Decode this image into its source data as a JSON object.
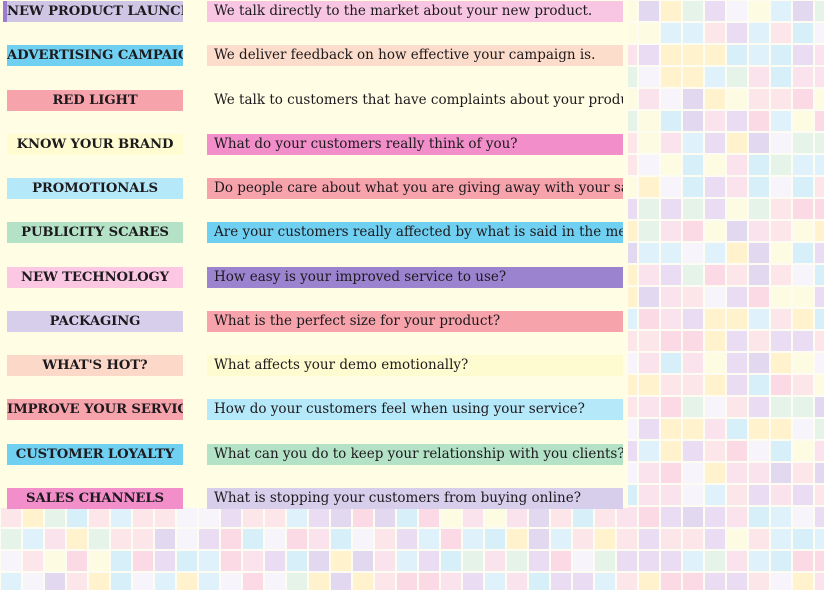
{
  "colors": {
    "panel": "#fffde3",
    "mosaic": [
      "#fbe3ee",
      "#e9dcf3",
      "#dff1fa",
      "#e5f3e8",
      "#fdfbe2",
      "#fbd9e5",
      "#e2d8f0",
      "#fff2cc",
      "#fde6ea",
      "#d7eff8",
      "#f7f4fb"
    ]
  },
  "rows": [
    {
      "name": "new-product-launch",
      "label": "NEW PRODUCT LAUNCH",
      "text": "We talk directly to the market about your new product.",
      "label_bg": "#cfc6e6",
      "desc_bg": "#f8c6e3",
      "bar": "#9b7ccd"
    },
    {
      "name": "advertising-campaign",
      "label": "ADVERTISING CAMPAIGN",
      "text": "We deliver feedback on how effective your campaign is.",
      "label_bg": "#6fd0f2",
      "desc_bg": "#fcdcca",
      "bar": ""
    },
    {
      "name": "red-light",
      "label": "RED LIGHT",
      "text": "We talk to customers that have complaints about your product.",
      "label_bg": "#f7a3ac",
      "desc_bg": "#fffde3",
      "bar": ""
    },
    {
      "name": "know-your-brand",
      "label": "KNOW YOUR BRAND",
      "text": "What do your customers really think of you?",
      "label_bg": "#fffcd2",
      "desc_bg": "#f28fcb",
      "bar": ""
    },
    {
      "name": "promotionals",
      "label": "PROMOTIONALS",
      "text": "Do people care about what you are giving away with your sales?",
      "label_bg": "#b5e8f8",
      "desc_bg": "#f7a3ac",
      "bar": ""
    },
    {
      "name": "publicity-scares",
      "label": "PUBLICITY SCARES",
      "text": "Are your customers really affected by what is said in the media?",
      "label_bg": "#b4e2c6",
      "desc_bg": "#6fd0f2",
      "bar": ""
    },
    {
      "name": "new-technology",
      "label": "NEW TECHNOLOGY",
      "text": "How easy is your improved service to use?",
      "label_bg": "#fbc7e3",
      "desc_bg": "#9c83cf",
      "bar": ""
    },
    {
      "name": "packaging",
      "label": "PACKAGING",
      "text": "What is the perfect size for your product?",
      "label_bg": "#d6ceeb",
      "desc_bg": "#f7a3ac",
      "bar": ""
    },
    {
      "name": "whats-hot",
      "label": "WHAT'S HOT?",
      "text": "What affects your demo emotionally?",
      "label_bg": "#fcd8c8",
      "desc_bg": "#fffbd0",
      "bar": ""
    },
    {
      "name": "improve-your-service",
      "label": "IMPROVE YOUR SERVICE",
      "text": "How do your customers feel when using your service?",
      "label_bg": "#f7a3ac",
      "desc_bg": "#b5e8f8",
      "bar": ""
    },
    {
      "name": "customer-loyalty",
      "label": "CUSTOMER LOYALTY",
      "text": "What can you do to keep your relationship with you clients?",
      "label_bg": "#6fd0f2",
      "desc_bg": "#b4e2c6",
      "bar": ""
    },
    {
      "name": "sales-channels",
      "label": "SALES CHANNELS",
      "text": "What is stopping your customers from buying online?",
      "label_bg": "#f28fcb",
      "desc_bg": "#d6ceeb",
      "bar": ""
    }
  ]
}
